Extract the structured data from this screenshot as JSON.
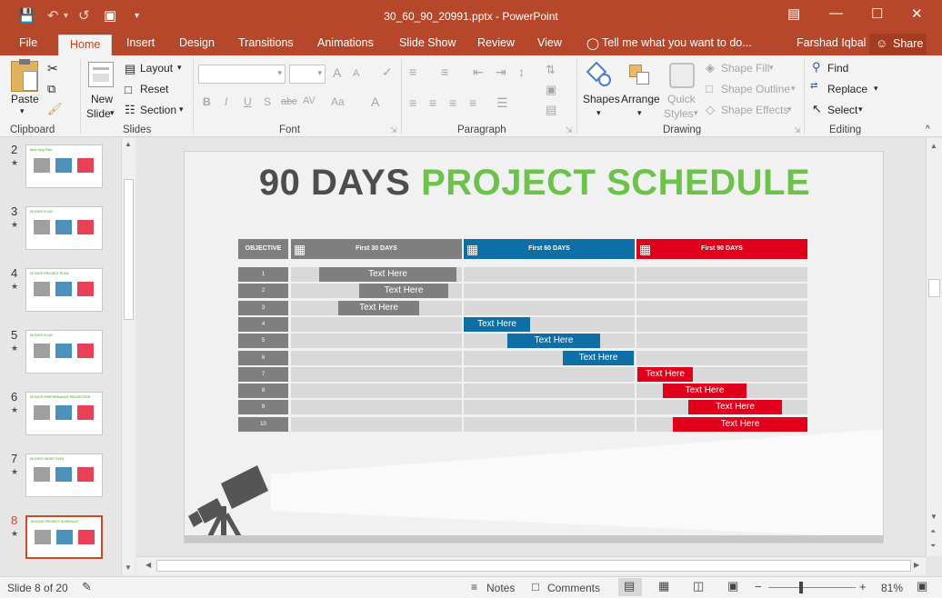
{
  "title_bar": {
    "filename": "30_60_90_20991.pptx - PowerPoint",
    "icons": [
      "save-icon",
      "undo-icon",
      "redo-icon",
      "present-icon",
      "customize-icon",
      "ribbon-options-icon",
      "minimize-icon",
      "maximize-icon",
      "close-icon"
    ]
  },
  "tabs": [
    "File",
    "Home",
    "Insert",
    "Design",
    "Transitions",
    "Animations",
    "Slide Show",
    "Review",
    "View"
  ],
  "tell_me": "Tell me what you want to do...",
  "user": "Farshad Iqbal",
  "share": "Share",
  "ribbon": {
    "clipboard": {
      "paste": "Paste",
      "label": "Clipboard"
    },
    "slides": {
      "new_slide_1": "New",
      "new_slide_2": "Slide",
      "layout": "Layout",
      "reset": "Reset",
      "section": "Section",
      "label": "Slides"
    },
    "font": {
      "bold": "B",
      "italic": "I",
      "underline": "U",
      "shadow": "S",
      "strike": "abc",
      "spacing": "AV",
      "case": "Aa",
      "color": "A",
      "grow": "A",
      "shrink": "A",
      "label": "Font"
    },
    "paragraph": {
      "label": "Paragraph"
    },
    "drawing": {
      "shapes": "Shapes",
      "arrange": "Arrange",
      "quick_1": "Quick",
      "quick_2": "Styles",
      "fill": "Shape Fill",
      "outline": "Shape Outline",
      "effects": "Shape Effects",
      "label": "Drawing"
    },
    "editing": {
      "find": "Find",
      "replace": "Replace",
      "select": "Select",
      "label": "Editing"
    }
  },
  "thumbnails": [
    {
      "num": "2",
      "title": "Next Step Plan"
    },
    {
      "num": "3",
      "title": "90 DAYS PLAN"
    },
    {
      "num": "4",
      "title": "90 DAYS PROJECT PLAN"
    },
    {
      "num": "5",
      "title": "90 DAYS PLAN"
    },
    {
      "num": "6",
      "title": "90 DAYS PERFORMANCE PROJECTION"
    },
    {
      "num": "7",
      "title": "90 DAYS OBJECTIVES"
    },
    {
      "num": "8",
      "title": "90 DAYS PROJECT SCHEDULE"
    }
  ],
  "star": "★",
  "slide": {
    "title_part1": "90 DAYS",
    "title_part2": "PROJECT SCHEDULE",
    "header_objective": "OBJECTIVE",
    "header_30": "First 30 DAYS",
    "header_60": "First 60 DAYS",
    "header_90": "First 90 DAYS",
    "row_labels": [
      "1",
      "2",
      "3",
      "4",
      "5",
      "6",
      "7",
      "8",
      "9",
      "10"
    ],
    "bar_text": "Text Here"
  },
  "colors": {
    "gray": "#7f7f7f",
    "blue": "#0e6ea6",
    "red": "#e0001b",
    "green": "#6cc24a",
    "title_dark": "#4d4d4d"
  },
  "status": {
    "slide": "Slide 8 of 20",
    "notes": "Notes",
    "comments": "Comments",
    "zoom": "81%",
    "minus": "−",
    "plus": "+"
  }
}
